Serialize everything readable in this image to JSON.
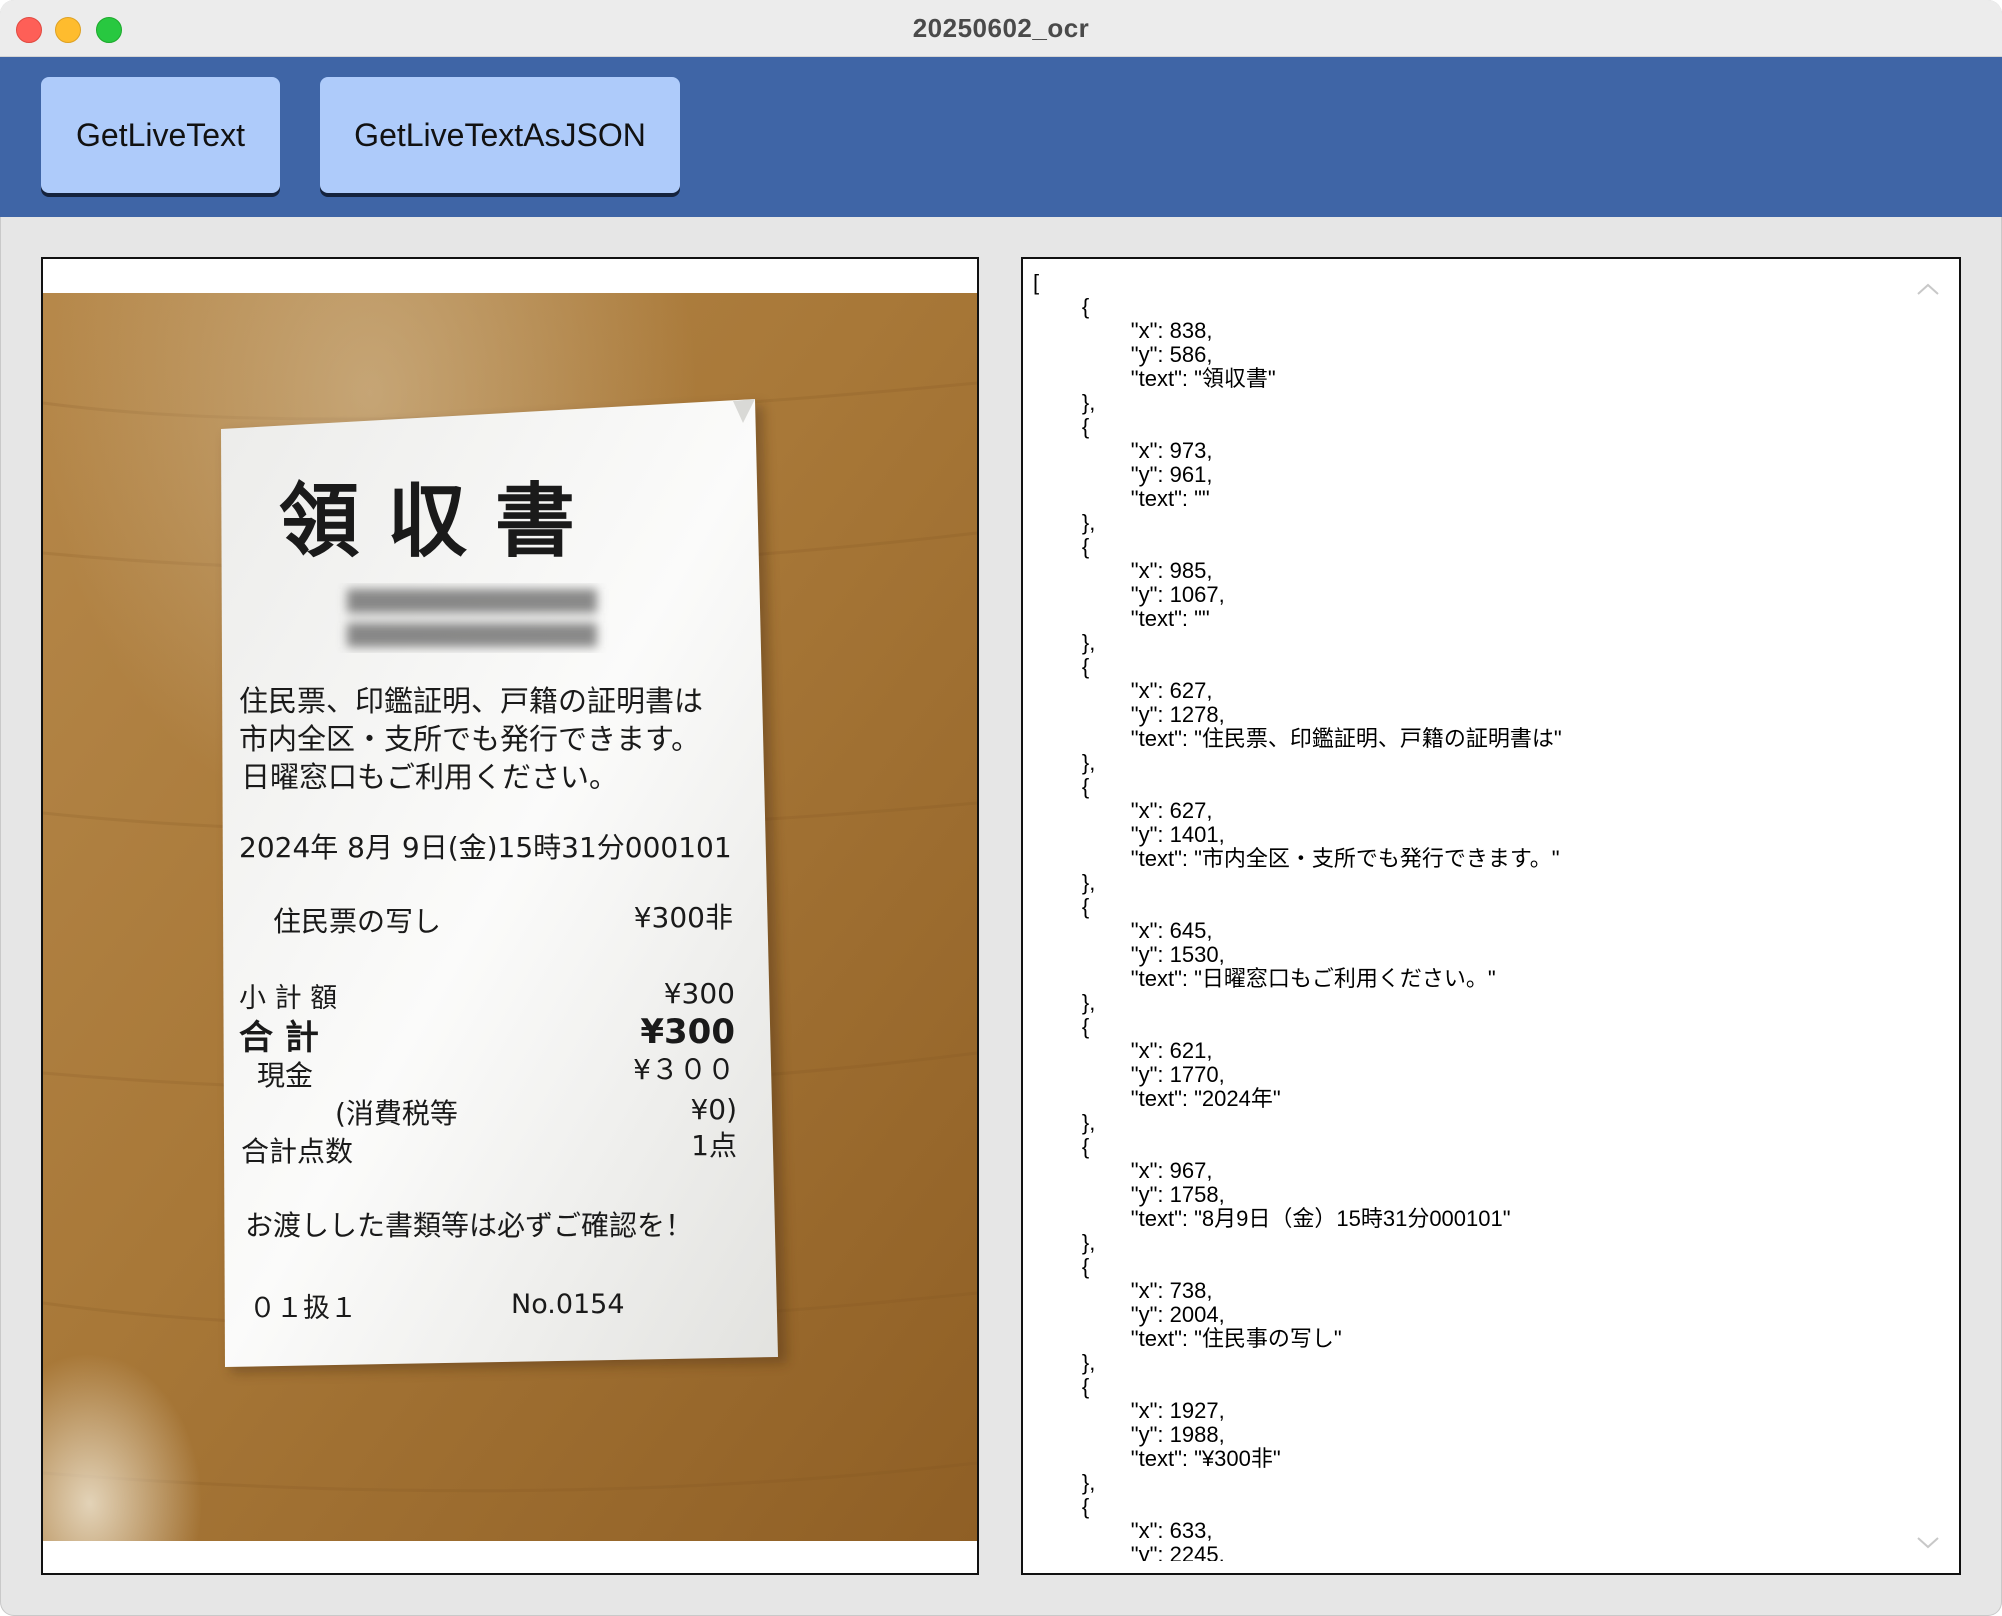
{
  "window": {
    "title": "20250602_ocr"
  },
  "toolbar": {
    "btn_live_text": "GetLiveText",
    "btn_live_json": "GetLiveTextAsJSON"
  },
  "receipt": {
    "title": "領 収 書",
    "notice_line1": "住民票、印鑑証明、戸籍の証明書は",
    "notice_line2": "市内全区・支所でも発行できます。",
    "notice_line3": "日曜窓口もご利用ください。",
    "datetime": "2024年 8月 9日(金)15時31分000101",
    "item_name": "住民票の写し",
    "item_price": "¥300非",
    "subtotal_label": "小 計 額",
    "subtotal_value": "¥300",
    "total_label": "合 計",
    "total_value": "¥300",
    "cash_label": "現金",
    "cash_value": "¥３００",
    "tax_label": "(消費税等",
    "tax_value": "¥0)",
    "count_label": "合計点数",
    "count_value": "1点",
    "reminder": "お渡しした書類等は必ずご確認を！",
    "code": "０１扱１",
    "number": "No.0154"
  },
  "json_output": "[\n\t{\n\t\t\"x\": 838,\n\t\t\"y\": 586,\n\t\t\"text\": \"領収書\"\n\t},\n\t{\n\t\t\"x\": 973,\n\t\t\"y\": 961,\n\t\t\"text\": \"\"\n\t},\n\t{\n\t\t\"x\": 985,\n\t\t\"y\": 1067,\n\t\t\"text\": \"\"\n\t},\n\t{\n\t\t\"x\": 627,\n\t\t\"y\": 1278,\n\t\t\"text\": \"住民票、印鑑証明、戸籍の証明書は\"\n\t},\n\t{\n\t\t\"x\": 627,\n\t\t\"y\": 1401,\n\t\t\"text\": \"市内全区・支所でも発行できます。\"\n\t},\n\t{\n\t\t\"x\": 645,\n\t\t\"y\": 1530,\n\t\t\"text\": \"日曜窓口もご利用ください。\"\n\t},\n\t{\n\t\t\"x\": 621,\n\t\t\"y\": 1770,\n\t\t\"text\": \"2024年\"\n\t},\n\t{\n\t\t\"x\": 967,\n\t\t\"y\": 1758,\n\t\t\"text\": \"8月9日（金）15時31分000101\"\n\t},\n\t{\n\t\t\"x\": 738,\n\t\t\"y\": 2004,\n\t\t\"text\": \"住民事の写し\"\n\t},\n\t{\n\t\t\"x\": 1927,\n\t\t\"y\": 1988,\n\t\t\"text\": \"¥300非\"\n\t},\n\t{\n\t\t\"x\": 633,\n\t\t\"y\": 2245,",
  "colors": {
    "toolbar": "#3f65a6",
    "button": "#aecbfa",
    "table_wood": "#a87838",
    "paper": "#f1f1ef"
  },
  "icons": {
    "scroll_up": "chevron-up-icon",
    "scroll_down": "chevron-down-icon"
  }
}
